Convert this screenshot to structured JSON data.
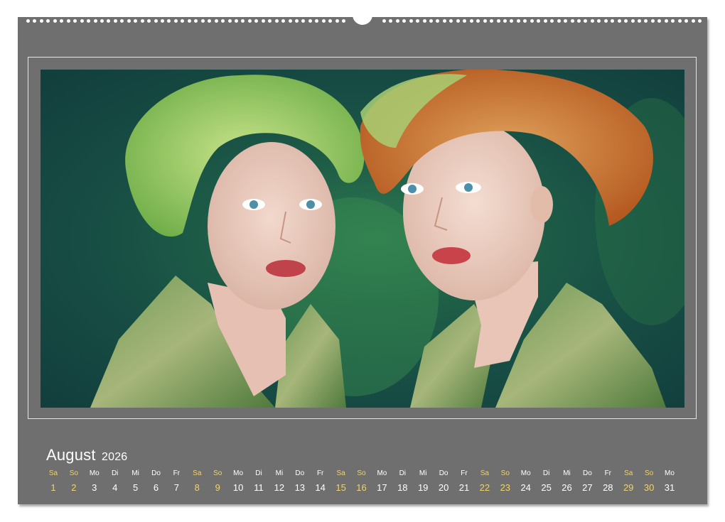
{
  "calendar": {
    "month": "August",
    "year": "2026",
    "weekend_color": "#f0d36a",
    "text_color": "#ffffff",
    "page_color": "#6f6f6f",
    "days": [
      {
        "wd": "Sa",
        "num": "1",
        "weekend": true
      },
      {
        "wd": "So",
        "num": "2",
        "weekend": true
      },
      {
        "wd": "Mo",
        "num": "3",
        "weekend": false
      },
      {
        "wd": "Di",
        "num": "4",
        "weekend": false
      },
      {
        "wd": "Mi",
        "num": "5",
        "weekend": false
      },
      {
        "wd": "Do",
        "num": "6",
        "weekend": false
      },
      {
        "wd": "Fr",
        "num": "7",
        "weekend": false
      },
      {
        "wd": "Sa",
        "num": "8",
        "weekend": true
      },
      {
        "wd": "So",
        "num": "9",
        "weekend": true
      },
      {
        "wd": "Mo",
        "num": "10",
        "weekend": false
      },
      {
        "wd": "Di",
        "num": "11",
        "weekend": false
      },
      {
        "wd": "Mi",
        "num": "12",
        "weekend": false
      },
      {
        "wd": "Do",
        "num": "13",
        "weekend": false
      },
      {
        "wd": "Fr",
        "num": "14",
        "weekend": false
      },
      {
        "wd": "Sa",
        "num": "15",
        "weekend": true
      },
      {
        "wd": "So",
        "num": "16",
        "weekend": true
      },
      {
        "wd": "Mo",
        "num": "17",
        "weekend": false
      },
      {
        "wd": "Di",
        "num": "18",
        "weekend": false
      },
      {
        "wd": "Mi",
        "num": "19",
        "weekend": false
      },
      {
        "wd": "Do",
        "num": "20",
        "weekend": false
      },
      {
        "wd": "Fr",
        "num": "21",
        "weekend": false
      },
      {
        "wd": "Sa",
        "num": "22",
        "weekend": true
      },
      {
        "wd": "So",
        "num": "23",
        "weekend": true
      },
      {
        "wd": "Mo",
        "num": "24",
        "weekend": false
      },
      {
        "wd": "Di",
        "num": "25",
        "weekend": false
      },
      {
        "wd": "Mi",
        "num": "26",
        "weekend": false
      },
      {
        "wd": "Do",
        "num": "27",
        "weekend": false
      },
      {
        "wd": "Fr",
        "num": "28",
        "weekend": false
      },
      {
        "wd": "Sa",
        "num": "29",
        "weekend": true
      },
      {
        "wd": "So",
        "num": "30",
        "weekend": true
      },
      {
        "wd": "Mo",
        "num": "31",
        "weekend": false
      }
    ]
  }
}
